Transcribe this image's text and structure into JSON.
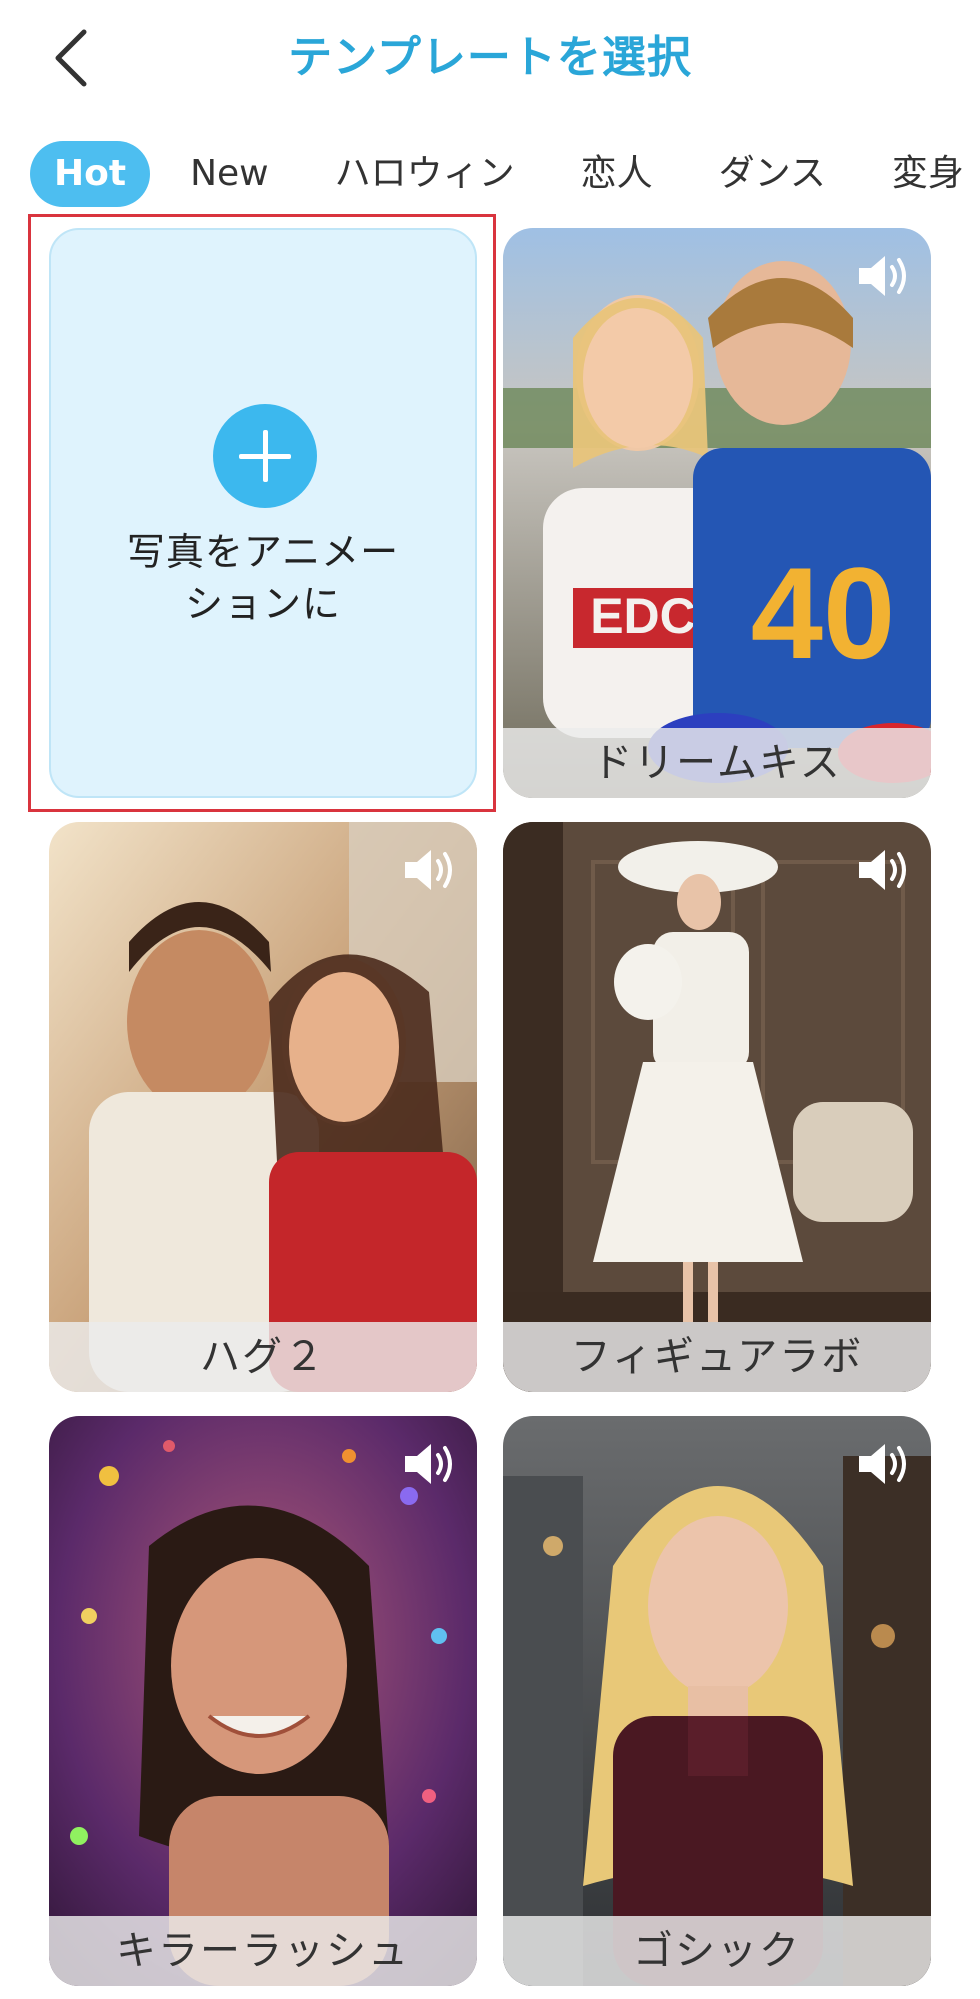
{
  "header": {
    "title": "テンプレートを選択"
  },
  "tabs": [
    {
      "label": "Hot",
      "active": true
    },
    {
      "label": "New",
      "active": false
    },
    {
      "label": "ハロウィン",
      "active": false
    },
    {
      "label": "恋人",
      "active": false
    },
    {
      "label": "ダンス",
      "active": false
    },
    {
      "label": "変身",
      "active": false
    }
  ],
  "upload": {
    "label_line1": "写真をアニメー",
    "label_line2": "ションに",
    "icon": "plus-icon"
  },
  "templates": [
    {
      "label": "ドリームキス",
      "icon": "sound-icon"
    },
    {
      "label": "ハグ２",
      "icon": "sound-icon"
    },
    {
      "label": "フィギュアラボ",
      "icon": "sound-icon"
    },
    {
      "label": "キラーラッシュ",
      "icon": "sound-icon"
    },
    {
      "label": "ゴシック",
      "icon": "sound-icon"
    }
  ],
  "colors": {
    "accent": "#2aa6d8",
    "tab_active_bg": "#4dbef0",
    "highlight_border": "#d9343e",
    "upload_bg": "#dff3fd"
  }
}
